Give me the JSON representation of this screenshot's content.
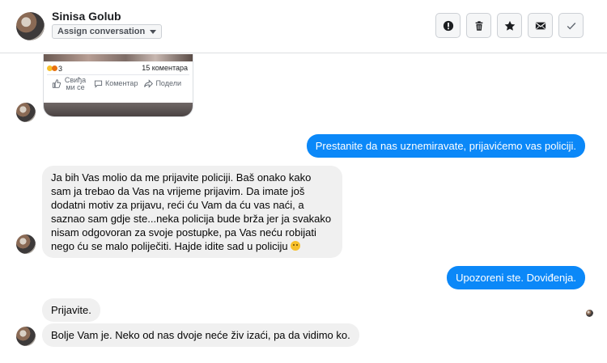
{
  "header": {
    "contact_name": "Sinisa Golub",
    "assign_label": "Assign conversation",
    "actions": [
      {
        "icon": "exclamation-icon"
      },
      {
        "icon": "trash-icon"
      },
      {
        "icon": "star-icon"
      },
      {
        "icon": "envelope-icon"
      },
      {
        "icon": "checkmark-icon"
      }
    ]
  },
  "shared_post": {
    "reaction_count": "3",
    "comments": "15 коментара",
    "like_label": "Свиђа ми се",
    "comment_label": "Коментар",
    "share_label": "Подели"
  },
  "messages": [
    {
      "id": "m1",
      "direction": "out",
      "text": "Prestanite da nas uznemiravate, prijavićemo vas policiji."
    },
    {
      "id": "m2",
      "direction": "in",
      "text": "Ja bih Vas molio da me prijavite policiji. Baš onako kako sam ja trebao da Vas na vrijeme prijavim. Da imate još dodatni motiv za prijavu, reći ću Vam da ću vas naći, a saznao sam gdje ste...neka policija bude brža jer ja svakako nisam odgovoran za svoje postupke, pa Vas neću robijati nego ću se malo poliječiti. Hajde idite sad u policiju"
    },
    {
      "id": "m3",
      "direction": "out",
      "text": "Upozoreni ste. Doviđenja."
    },
    {
      "id": "m4",
      "direction": "in",
      "text": "Prijavite."
    },
    {
      "id": "m5",
      "direction": "in",
      "text": "Bolje Vam je. Neko od nas dvoje neće živ izaći, pa da vidimo ko."
    }
  ],
  "colors": {
    "outgoing_bubble": "#0b88f8",
    "incoming_bubble": "#f0f0f0"
  }
}
